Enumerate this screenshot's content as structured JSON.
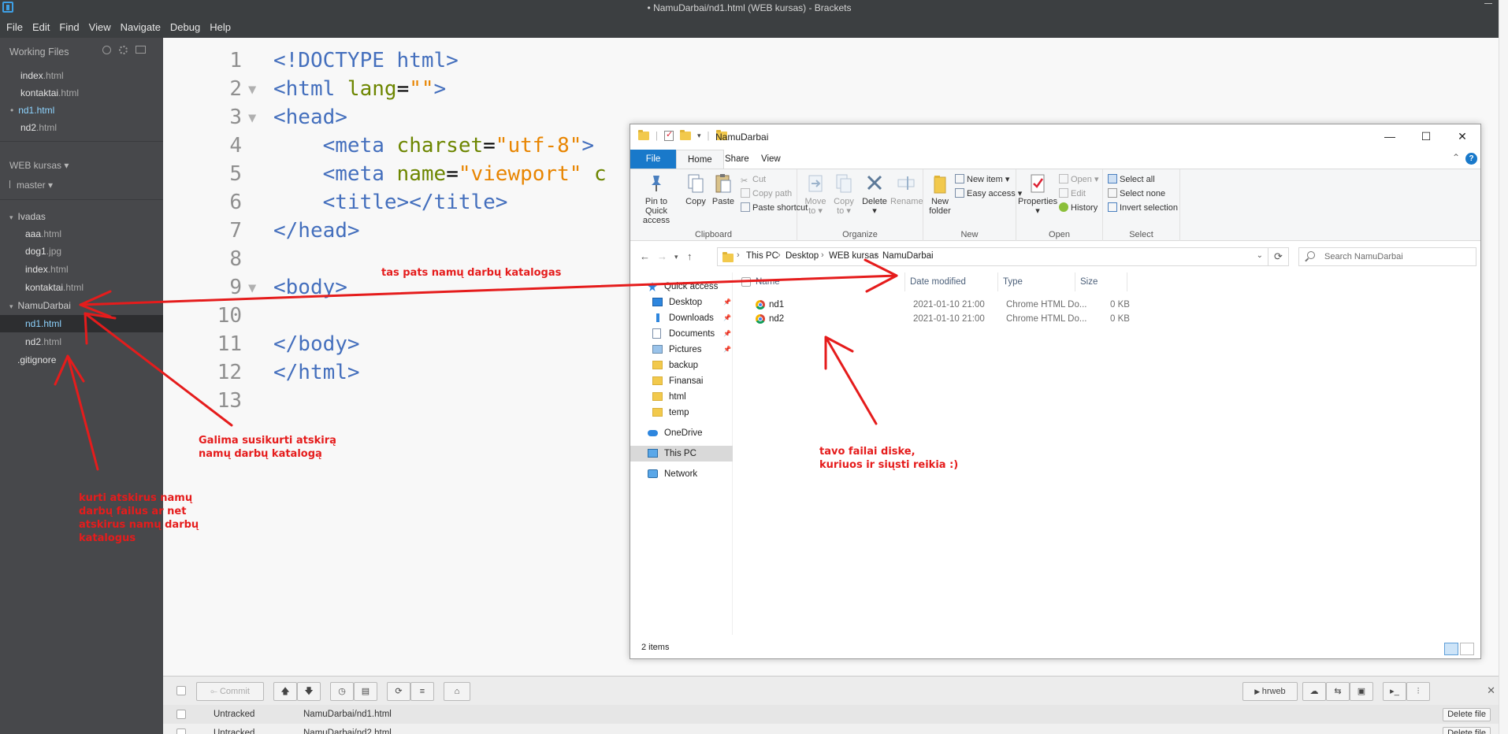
{
  "window": {
    "title": "• NamuDarbai/nd1.html (WEB kursas) - Brackets"
  },
  "menu": [
    "File",
    "Edit",
    "Find",
    "View",
    "Navigate",
    "Debug",
    "Help"
  ],
  "sidebar": {
    "working_files_header": "Working Files",
    "working_files": [
      {
        "name": "index",
        "ext": ".html"
      },
      {
        "name": "kontaktai",
        "ext": ".html"
      },
      {
        "name": "nd1",
        "ext": ".html",
        "dirty": "•"
      },
      {
        "name": "nd2",
        "ext": ".html"
      }
    ],
    "project": "WEB kursas ▾",
    "branch": "master ▾",
    "tree": [
      {
        "name": "Ivadas",
        "prefix": "▾"
      },
      {
        "name": "aaa",
        "ext": ".html"
      },
      {
        "name": "dog1",
        "ext": ".jpg"
      },
      {
        "name": "index",
        "ext": ".html"
      },
      {
        "name": "kontaktai",
        "ext": ".html"
      },
      {
        "name": "NamuDarbai",
        "prefix": "▾"
      },
      {
        "name": "nd1",
        "ext": ".html"
      },
      {
        "name": "nd2",
        "ext": ".html"
      },
      {
        "name": ".gitignore",
        "ext": ""
      }
    ]
  },
  "editor": {
    "line_numbers": [
      "1",
      "2",
      "3",
      "4",
      "5",
      "6",
      "7",
      "8",
      "9",
      "10",
      "11",
      "12",
      "13"
    ],
    "lines": [
      "<!DOCTYPE html>",
      "<html lang=\"\">",
      "<head>",
      "    <meta charset=\"utf-8\">",
      "    <meta name=\"viewport\" c",
      "    <title></title>",
      "</head>",
      "",
      "<body>",
      "",
      "</body>",
      "</html>",
      ""
    ]
  },
  "git": {
    "commit_label": "Commit",
    "remote_label": "hrweb",
    "rows": [
      {
        "status": "Untracked",
        "file": "NamuDarbai/nd1.html",
        "action": "Delete file"
      },
      {
        "status": "Untracked",
        "file": "NamuDarbai/nd2.html",
        "action": "Delete file"
      }
    ]
  },
  "explorer": {
    "title": "NamuDarbai",
    "tabs": {
      "file": "File",
      "home": "Home",
      "share": "Share",
      "view": "View"
    },
    "ribbon": {
      "clipboard": {
        "label": "Clipboard",
        "pin": "Pin to Quick access",
        "copy": "Copy",
        "paste": "Paste",
        "cut": "Cut",
        "copy_path": "Copy path",
        "paste_shortcut": "Paste shortcut"
      },
      "organize": {
        "label": "Organize",
        "move_to": "Move to ▾",
        "copy_to": "Copy to ▾",
        "delete": "Delete ▾",
        "rename": "Rename"
      },
      "new": {
        "label": "New",
        "new_folder": "New folder",
        "new_item": "New item ▾",
        "easy_access": "Easy access ▾"
      },
      "open": {
        "label": "Open",
        "properties": "Properties ▾",
        "open": "Open ▾",
        "edit": "Edit",
        "history": "History"
      },
      "select": {
        "label": "Select",
        "select_all": "Select all",
        "select_none": "Select none",
        "invert": "Invert selection"
      }
    },
    "breadcrumb": [
      "This PC",
      "Desktop",
      "WEB kursas",
      "NamuDarbai"
    ],
    "search_placeholder": "Search NamuDarbai",
    "nav": [
      {
        "label": "Quick access",
        "icon": "star-icon"
      },
      {
        "label": "Desktop",
        "icon": "desktop-icon",
        "pinned": true
      },
      {
        "label": "Downloads",
        "icon": "download-icon",
        "pinned": true
      },
      {
        "label": "Documents",
        "icon": "document-icon",
        "pinned": true
      },
      {
        "label": "Pictures",
        "icon": "picture-icon",
        "pinned": true
      },
      {
        "label": "backup",
        "icon": "folder-icon"
      },
      {
        "label": "Finansai",
        "icon": "folder-icon"
      },
      {
        "label": "html",
        "icon": "folder-icon"
      },
      {
        "label": "temp",
        "icon": "folder-icon"
      },
      {
        "label": "OneDrive",
        "icon": "cloud-icon"
      },
      {
        "label": "This PC",
        "icon": "computer-icon"
      },
      {
        "label": "Network",
        "icon": "network-icon"
      }
    ],
    "columns": {
      "name": "Name",
      "date": "Date modified",
      "type": "Type",
      "size": "Size"
    },
    "files": [
      {
        "name": "nd1",
        "date": "2021-01-10 21:00",
        "type": "Chrome HTML Do...",
        "size": "0 KB"
      },
      {
        "name": "nd2",
        "date": "2021-01-10 21:00",
        "type": "Chrome HTML Do...",
        "size": "0 KB"
      }
    ],
    "status": "2 items"
  },
  "annotations": {
    "same_folder": "tas pats namų darbų katalogas",
    "separate_folder": "Galima susikurti atskirą\nnamų darbų katalogą",
    "create_separately": "kurti atskirus namų\ndarbų failus ar net\natskirus namų darbų\nkatalogus",
    "disk_files": "tavo failai diske,\nkuriuos ir siųsti reikia :)"
  },
  "colors": {
    "annotation": "#e51c1c",
    "accent": "#1979ca",
    "sidebar": "#47484b"
  }
}
